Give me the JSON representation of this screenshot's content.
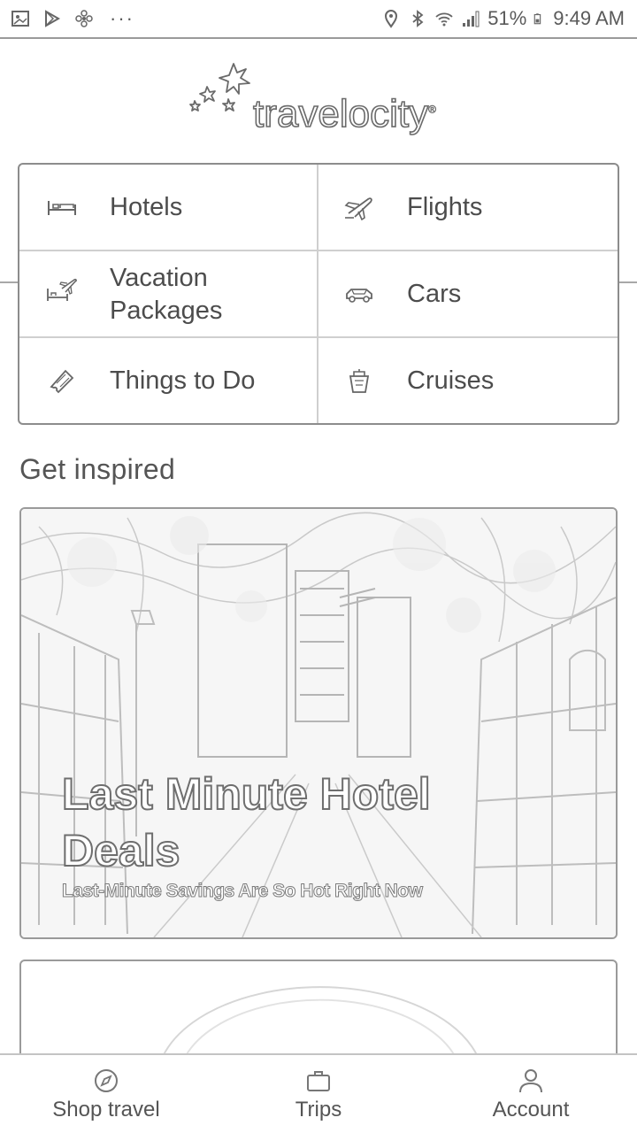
{
  "status_bar": {
    "more_indicator": "···",
    "battery_percent": "51%",
    "time": "9:49 AM",
    "icons": [
      "gallery-icon",
      "play-store-icon",
      "pinwheel-icon",
      "location-icon",
      "bluetooth-icon",
      "wifi-icon",
      "signal-icon",
      "battery-icon"
    ]
  },
  "logo": {
    "text": "travelocity",
    "reg": "®"
  },
  "categories": [
    {
      "label": "Hotels",
      "icon": "bed-icon"
    },
    {
      "label": "Flights",
      "icon": "airplane-icon"
    },
    {
      "label": "Vacation\nPackages",
      "icon": "package-icon"
    },
    {
      "label": "Cars",
      "icon": "car-icon"
    },
    {
      "label": "Things to Do",
      "icon": "ticket-icon"
    },
    {
      "label": "Cruises",
      "icon": "ship-icon"
    }
  ],
  "inspired": {
    "title": "Get inspired",
    "deal": {
      "title": "Last Minute Hotel Deals",
      "subtitle": "Last-Minute Savings Are So Hot Right Now"
    }
  },
  "bottom_nav": [
    {
      "label": "Shop travel",
      "icon": "compass-icon"
    },
    {
      "label": "Trips",
      "icon": "suitcase-icon"
    },
    {
      "label": "Account",
      "icon": "person-icon"
    }
  ]
}
